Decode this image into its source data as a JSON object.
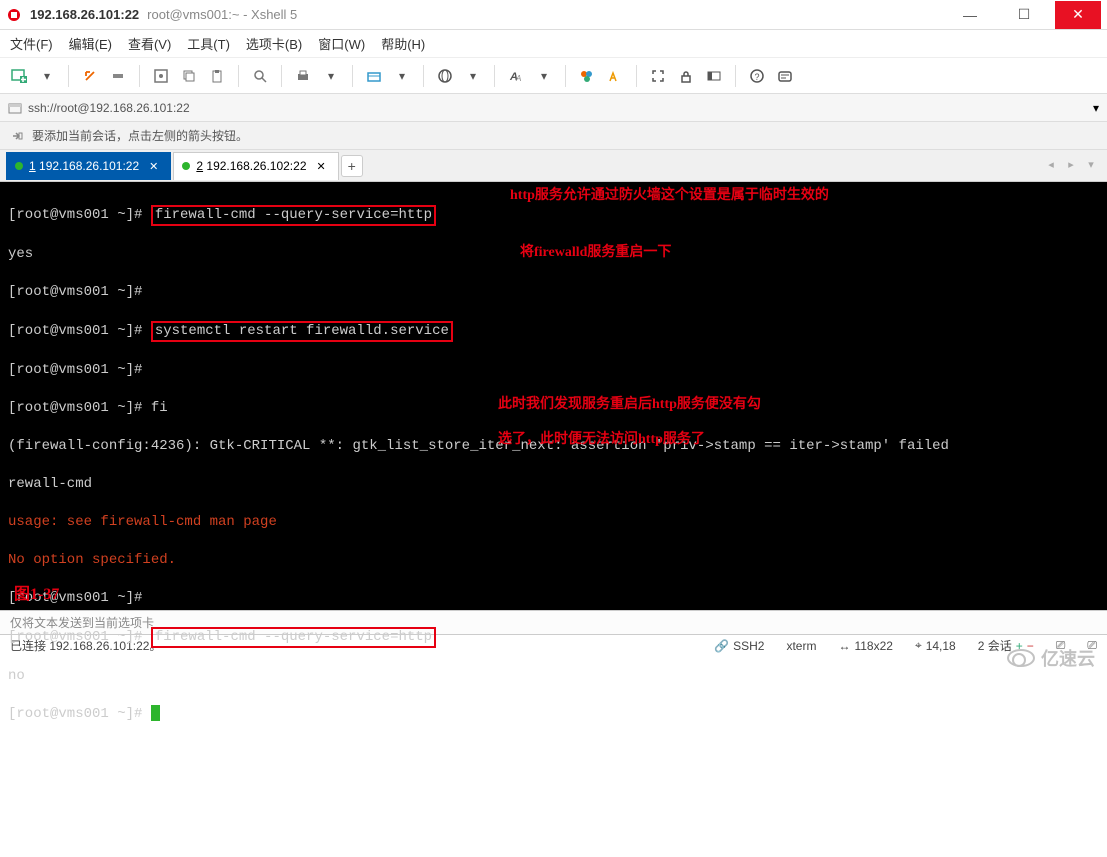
{
  "window": {
    "title": "192.168.26.101:22",
    "subtitle": "root@vms001:~ - Xshell 5"
  },
  "menu": {
    "file": "文件(F)",
    "edit": "编辑(E)",
    "view": "查看(V)",
    "tools": "工具(T)",
    "tab": "选项卡(B)",
    "window": "窗口(W)",
    "help": "帮助(H)"
  },
  "address": "ssh://root@192.168.26.101:22",
  "notice": "要添加当前会话，点击左侧的箭头按钮。",
  "tabs": [
    {
      "n": "1",
      "label": "192.168.26.101:22",
      "active": true
    },
    {
      "n": "2",
      "label": "192.168.26.102:22",
      "active": false
    }
  ],
  "term": {
    "prompt": "[root@vms001 ~]# ",
    "cmd1": "firewall-cmd --query-service=http",
    "out1": "yes",
    "cmd2": "systemctl restart firewalld.service",
    "cmd3": "fi",
    "gtk": "(firewall-config:4236): Gtk-CRITICAL **: gtk_list_store_iter_next: assertion 'priv->stamp == iter->stamp' failed",
    "gtk2": "rewall-cmd",
    "err1": "usage: see firewall-cmd man page",
    "err2": "No option specified.",
    "cmd4": "firewall-cmd --query-service=http",
    "out2": "no",
    "anno1": "http服务允许通过防火墙这个设置是属于临时生效的",
    "anno2": "将firewalld服务重启一下",
    "anno3a": "此时我们发现服务重启后http服务便没有勾",
    "anno3b": "选了，此时便无法访问http服务了",
    "figlabel": "图1-37"
  },
  "inputbar": "仅将文本发送到当前选项卡",
  "status": {
    "conn": "已连接 192.168.26.101:22。",
    "proto": "SSH2",
    "termtype": "xterm",
    "size": "118x22",
    "pos": "14,18",
    "sess": "2 会话"
  },
  "watermark": "亿速云"
}
